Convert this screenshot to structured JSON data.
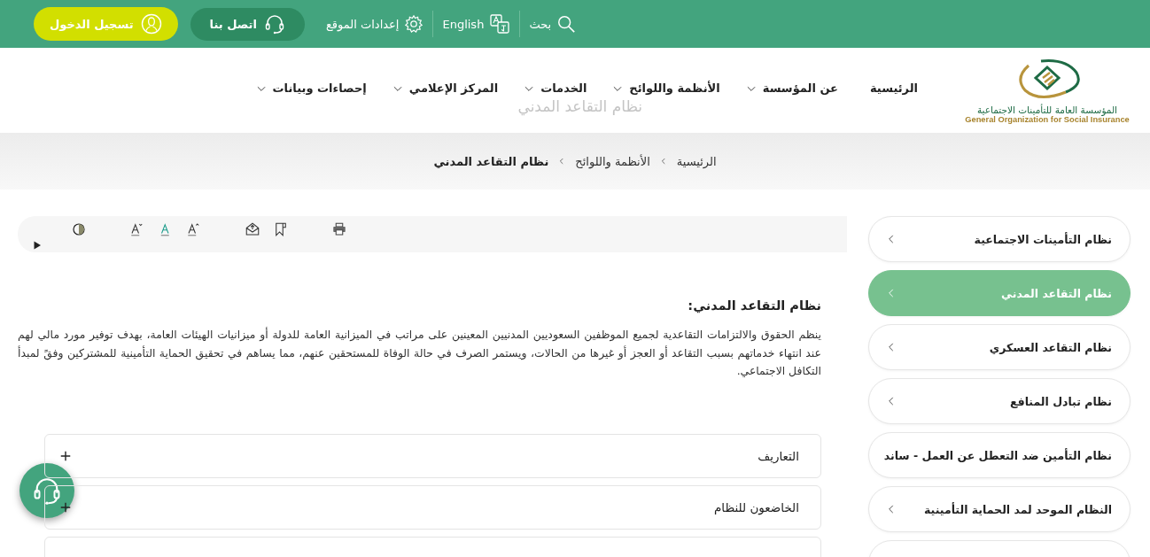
{
  "top_bar": {
    "search": "بحث",
    "language": "English",
    "settings": "إعدادات الموقع",
    "contact_button": "اتصل بنا",
    "login_button": "تسجيل الدخول"
  },
  "header": {
    "logo_arabic": "المؤسسة العامة للتأمينات الاجتماعية",
    "logo_english": "General Organization for Social Insurance",
    "page_title": "نظام التقاعد المدني",
    "nav": [
      {
        "label": "الرئيسية",
        "dropdown": false
      },
      {
        "label": "عن المؤسسة",
        "dropdown": true
      },
      {
        "label": "الأنظمة واللوائح",
        "dropdown": true
      },
      {
        "label": "الخدمات",
        "dropdown": true
      },
      {
        "label": "المركز الإعلامي",
        "dropdown": true
      },
      {
        "label": "إحصاءات وبيانات",
        "dropdown": true
      }
    ]
  },
  "breadcrumb": [
    {
      "label": "الرئيسية",
      "current": false
    },
    {
      "label": "الأنظمة واللوائح",
      "current": false
    },
    {
      "label": "نظام التقاعد المدني",
      "current": true
    }
  ],
  "sidebar": {
    "items": [
      {
        "label": "نظام التأمينات الاجتماعية",
        "selected": false
      },
      {
        "label": "نظام التقاعد المدني",
        "selected": true
      },
      {
        "label": "نظام التقاعد العسكري",
        "selected": false
      },
      {
        "label": "نظام تبادل المنافع",
        "selected": false
      },
      {
        "label": "نظام التأمين ضد التعطل عن العمل - ساند",
        "selected": false
      },
      {
        "label": "النظام الموحد لمد الحماية التأمينية",
        "selected": false
      }
    ]
  },
  "content": {
    "heading": "نظام التقاعد المدني:",
    "paragraph": "ينظم الحقوق والالتزامات التقاعدية لجميع الموظفين السعوديين المدنيين المعينين على مراتب في الميزانية العامة للدولة أو ميزانيات الهيئات العامة، بهدف توفير مورد مالي لهم عند انتهاء خدماتهم بسبب التقاعد أو العجز أو غيرها من الحالات، ويستمر الصرف في حالة الوفاة للمستحقين عنهم، مما يساهم في تحقيق الحماية التأمينية للمشتركين وفقً لمبدأ التكافل الاجتماعي.",
    "accordion": [
      {
        "title": "التعاريف"
      },
      {
        "title": "الخاضعون للنظام"
      }
    ]
  }
}
